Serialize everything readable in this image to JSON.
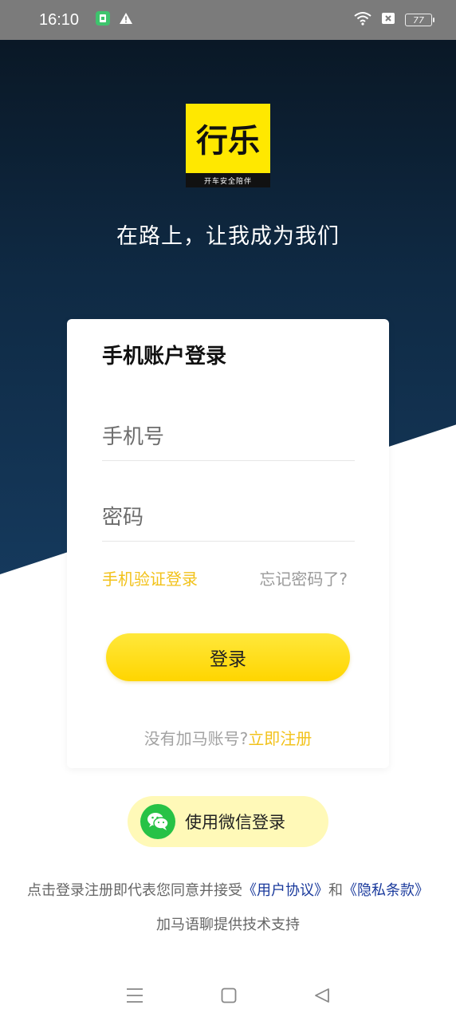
{
  "status_bar": {
    "time": "16:10",
    "battery": "77",
    "icons": [
      "app-notification-icon",
      "warning-icon",
      "wifi-icon",
      "sim-blocked-icon",
      "battery-icon"
    ]
  },
  "logo": {
    "main": "行乐",
    "tagline": "开车安全陪伴"
  },
  "slogan": "在路上，让我成为我们",
  "login_card": {
    "title": "手机账户登录",
    "phone_placeholder": "手机号",
    "password_placeholder": "密码",
    "sms_login": "手机验证登录",
    "forgot_password": "忘记密码了?",
    "login_button": "登录",
    "no_account": "没有加马账号?",
    "register_now": "立即注册"
  },
  "wechat": {
    "label": "使用微信登录"
  },
  "agreement": {
    "prefix": "点击登录注册即代表您同意并接受",
    "user_agreement": "《用户协议》",
    "and": "和",
    "privacy_policy": "《隐私条款》"
  },
  "support_text": "加马语聊提供技术支持",
  "colors": {
    "accent_yellow": "#ffd500",
    "link_yellow": "#f2c21a",
    "hero_dark": "#0f2a44",
    "wechat_green": "#27c246",
    "doc_link_blue": "#1a3a9c"
  }
}
